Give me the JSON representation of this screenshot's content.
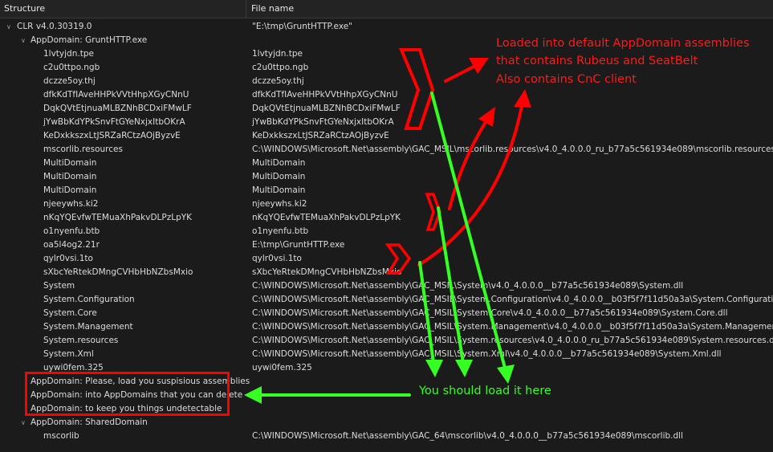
{
  "columns": {
    "structure": "Structure",
    "file_name": "File name"
  },
  "rows": [
    {
      "name": "CLR v4.0.30319.0",
      "file": "\"E:\\tmp\\GruntHTTP.exe\""
    },
    {
      "name": "AppDomain: GruntHTTP.exe",
      "file": ""
    },
    {
      "name": "1lvtyjdn.tpe",
      "file": "1lvtyjdn.tpe"
    },
    {
      "name": "c2u0ttpo.ngb",
      "file": "c2u0ttpo.ngb"
    },
    {
      "name": "dczze5oy.thj",
      "file": "dczze5oy.thj"
    },
    {
      "name": "dfkKdTfIAveHHPkVVtHhpXGyCNnU",
      "file": "dfkKdTfIAveHHPkVVtHhpXGyCNnU"
    },
    {
      "name": "DqkQVtEtjnuaMLBZNhBCDxiFMwLF",
      "file": "DqkQVtEtjnuaMLBZNhBCDxiFMwLF"
    },
    {
      "name": "jYwBbKdYPkSnvFtGYeNxjxItbOKrA",
      "file": "jYwBbKdYPkSnvFtGYeNxjxItbOKrA"
    },
    {
      "name": "KeDxkkszxLtJSRZaRCtzAOjByzvE",
      "file": "KeDxkkszxLtJSRZaRCtzAOjByzvE"
    },
    {
      "name": "mscorlib.resources",
      "file": "C:\\WINDOWS\\Microsoft.Net\\assembly\\GAC_MSIL\\mscorlib.resources\\v4.0_4.0.0.0_ru_b77a5c561934e089\\mscorlib.resources.dll"
    },
    {
      "name": "MultiDomain",
      "file": "MultiDomain"
    },
    {
      "name": "MultiDomain",
      "file": "MultiDomain"
    },
    {
      "name": "MultiDomain",
      "file": "MultiDomain"
    },
    {
      "name": "njeeywhs.ki2",
      "file": "njeeywhs.ki2"
    },
    {
      "name": "nKqYQEvfwTEMuaXhPakvDLPzLpYK",
      "file": "nKqYQEvfwTEMuaXhPakvDLPzLpYK"
    },
    {
      "name": "o1nyenfu.btb",
      "file": "o1nyenfu.btb"
    },
    {
      "name": "oa5l4og2.21r",
      "file": "E:\\tmp\\GruntHTTP.exe"
    },
    {
      "name": "qylr0vsi.1to",
      "file": "qylr0vsi.1to"
    },
    {
      "name": "sXbcYeRtekDMngCVHbHbNZbsMxio",
      "file": "sXbcYeRtekDMngCVHbHbNZbsMxio"
    },
    {
      "name": "System",
      "file": "C:\\WINDOWS\\Microsoft.Net\\assembly\\GAC_MSIL\\System\\v4.0_4.0.0.0__b77a5c561934e089\\System.dll"
    },
    {
      "name": "System.Configuration",
      "file": "C:\\WINDOWS\\Microsoft.Net\\assembly\\GAC_MSIL\\System.Configuration\\v4.0_4.0.0.0__b03f5f7f11d50a3a\\System.Configuration.dll"
    },
    {
      "name": "System.Core",
      "file": "C:\\WINDOWS\\Microsoft.Net\\assembly\\GAC_MSIL\\System.Core\\v4.0_4.0.0.0__b77a5c561934e089\\System.Core.dll"
    },
    {
      "name": "System.Management",
      "file": "C:\\WINDOWS\\Microsoft.Net\\assembly\\GAC_MSIL\\System.Management\\v4.0_4.0.0.0__b03f5f7f11d50a3a\\System.Management.dll"
    },
    {
      "name": "System.resources",
      "file": "C:\\WINDOWS\\Microsoft.Net\\assembly\\GAC_MSIL\\System.resources\\v4.0_4.0.0.0_ru_b77a5c561934e089\\System.resources.dll"
    },
    {
      "name": "System.Xml",
      "file": "C:\\WINDOWS\\Microsoft.Net\\assembly\\GAC_MSIL\\System.Xml\\v4.0_4.0.0.0__b77a5c561934e089\\System.Xml.dll"
    },
    {
      "name": "uywi0fem.325",
      "file": "uywi0fem.325"
    },
    {
      "name": "AppDomain: Please, load you suspisious assemblies",
      "file": ""
    },
    {
      "name": "AppDomain: into AppDomains that you can delete",
      "file": ""
    },
    {
      "name": "AppDomain: to keep you things undetectable",
      "file": ""
    },
    {
      "name": "AppDomain: SharedDomain",
      "file": ""
    },
    {
      "name": "mscorlib",
      "file": "C:\\WINDOWS\\Microsoft.Net\\assembly\\GAC_64\\mscorlib\\v4.0_4.0.0.0__b77a5c561934e089\\mscorlib.dll"
    }
  ],
  "annotations": {
    "red_lines": [
      "Loaded into default AppDomain assemblies",
      "that contains Rubeus and SeatBelt",
      "Also contains CnC client"
    ],
    "green_text": "You should load it here",
    "red_color": "#ff0000",
    "green_color": "#2bff1b"
  }
}
